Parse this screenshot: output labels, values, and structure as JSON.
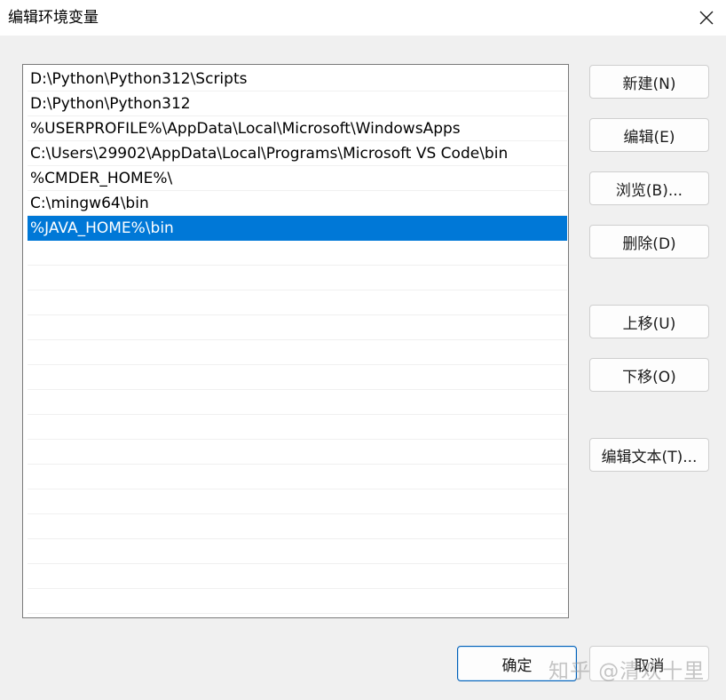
{
  "window": {
    "title": "编辑环境变量"
  },
  "path_list": {
    "rows": [
      {
        "value": "D:\\Python\\Python312\\Scripts",
        "selected": false
      },
      {
        "value": "D:\\Python\\Python312",
        "selected": false
      },
      {
        "value": "%USERPROFILE%\\AppData\\Local\\Microsoft\\WindowsApps",
        "selected": false
      },
      {
        "value": "C:\\Users\\29902\\AppData\\Local\\Programs\\Microsoft VS Code\\bin",
        "selected": false
      },
      {
        "value": "%CMDER_HOME%\\",
        "selected": false
      },
      {
        "value": "C:\\mingw64\\bin",
        "selected": false
      },
      {
        "value": "%JAVA_HOME%\\bin",
        "selected": true
      },
      {
        "value": "",
        "selected": false
      },
      {
        "value": "",
        "selected": false
      },
      {
        "value": "",
        "selected": false
      },
      {
        "value": "",
        "selected": false
      },
      {
        "value": "",
        "selected": false
      },
      {
        "value": "",
        "selected": false
      },
      {
        "value": "",
        "selected": false
      },
      {
        "value": "",
        "selected": false
      },
      {
        "value": "",
        "selected": false
      },
      {
        "value": "",
        "selected": false
      },
      {
        "value": "",
        "selected": false
      },
      {
        "value": "",
        "selected": false
      },
      {
        "value": "",
        "selected": false
      },
      {
        "value": "",
        "selected": false
      },
      {
        "value": "",
        "selected": false
      }
    ]
  },
  "buttons": {
    "new": "新建(N)",
    "edit": "编辑(E)",
    "browse": "浏览(B)...",
    "delete": "删除(D)",
    "move_up": "上移(U)",
    "move_down": "下移(O)",
    "edit_text": "编辑文本(T)...",
    "ok": "确定",
    "cancel": "取消"
  },
  "watermark": {
    "text": "知乎 @清欢十里"
  },
  "colors": {
    "selection": "#0078d7",
    "window_bg": "#f0f0f0"
  }
}
